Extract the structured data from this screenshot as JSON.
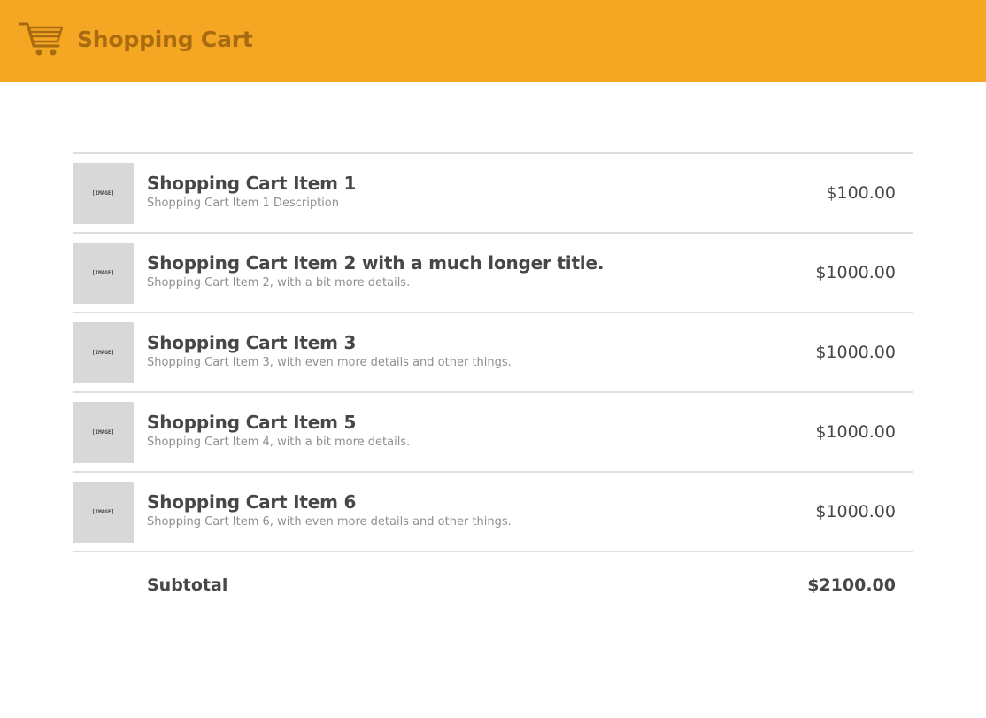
{
  "header": {
    "title": "Shopping Cart",
    "icon": "shopping-cart-icon",
    "background_color": "#f5a623",
    "accent_color": "#a86b10"
  },
  "cart": {
    "image_placeholder": "[IMAGE]",
    "items": [
      {
        "title": "Shopping Cart Item 1",
        "description": "Shopping Cart Item 1 Description",
        "price": "$100.00"
      },
      {
        "title": "Shopping Cart Item 2 with a much longer title.",
        "description": "Shopping Cart Item 2, with a bit more details.",
        "price": "$1000.00"
      },
      {
        "title": "Shopping Cart Item 3",
        "description": "Shopping Cart Item 3, with even more details and other things.",
        "price": "$1000.00"
      },
      {
        "title": "Shopping Cart Item 5",
        "description": "Shopping Cart Item 4, with a bit more details.",
        "price": "$1000.00"
      },
      {
        "title": "Shopping Cart Item 6",
        "description": "Shopping Cart Item 6, with even more details and other things.",
        "price": "$1000.00"
      }
    ],
    "subtotal_label": "Subtotal",
    "subtotal_value": "$2100.00"
  }
}
